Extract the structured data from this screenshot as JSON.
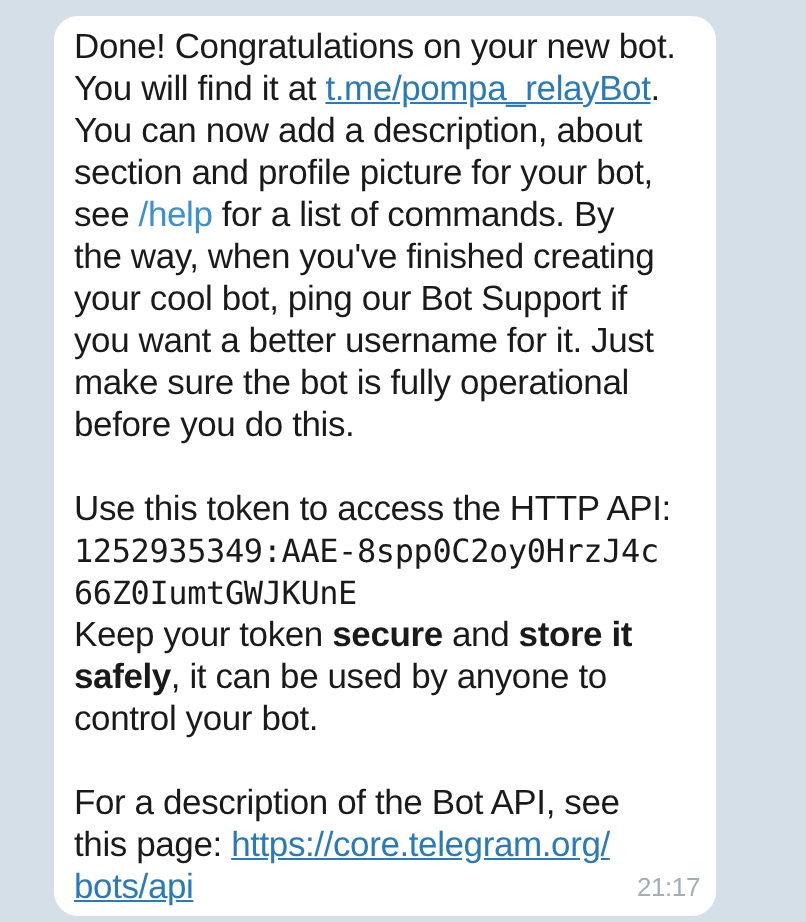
{
  "message": {
    "time": "21:17",
    "paragraphs": [
      {
        "lines": [
          [
            {
              "kind": "text",
              "text": "Done! Congratulations on your new bot."
            }
          ],
          [
            {
              "kind": "text",
              "text": "You will find it at "
            },
            {
              "kind": "link",
              "text": "t.me/pompa_relayBot"
            },
            {
              "kind": "text",
              "text": "."
            }
          ],
          [
            {
              "kind": "text",
              "text": "You can now add a description, about"
            }
          ],
          [
            {
              "kind": "text",
              "text": "section and profile picture for your bot,"
            }
          ],
          [
            {
              "kind": "text",
              "text": "see "
            },
            {
              "kind": "command",
              "text": "/help"
            },
            {
              "kind": "text",
              "text": " for a list of commands. By"
            }
          ],
          [
            {
              "kind": "text",
              "text": "the way, when you've finished creating"
            }
          ],
          [
            {
              "kind": "text",
              "text": "your cool bot, ping our Bot Support if"
            }
          ],
          [
            {
              "kind": "text",
              "text": "you want a better username for it. Just"
            }
          ],
          [
            {
              "kind": "text",
              "text": "make sure the bot is fully operational"
            }
          ],
          [
            {
              "kind": "text",
              "text": "before you do this."
            }
          ]
        ]
      },
      {
        "lines": [
          [
            {
              "kind": "text",
              "text": "Use this token to access the HTTP API:"
            }
          ],
          [
            {
              "kind": "code",
              "text": "1252935349:AAE-8spp0C2oy0HrzJ4c"
            }
          ],
          [
            {
              "kind": "code",
              "text": "66Z0IumtGWJKUnE"
            }
          ],
          [
            {
              "kind": "text",
              "text": "Keep your token **secure** and **store it**"
            }
          ],
          [
            {
              "kind": "text",
              "text": "**safely**, it can be used by anyone to"
            }
          ],
          [
            {
              "kind": "text",
              "text": "control your bot."
            }
          ]
        ]
      },
      {
        "lines": [
          [
            {
              "kind": "text",
              "text": "For a description of the Bot API, see"
            }
          ],
          [
            {
              "kind": "text",
              "text": "this page: "
            },
            {
              "kind": "link",
              "text": "https://core.telegram.org/"
            }
          ],
          [
            {
              "kind": "link",
              "text": "bots/api"
            }
          ]
        ]
      }
    ]
  }
}
